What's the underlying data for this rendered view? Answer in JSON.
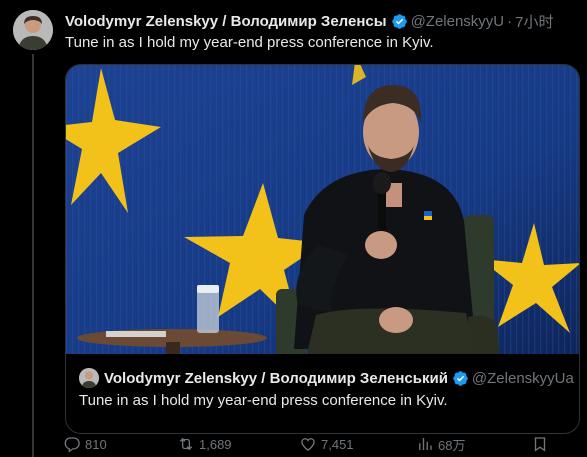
{
  "tweet": {
    "author_name": "Volodymyr Zelenskyy / Володимир Зеленсы",
    "handle": "@ZelenskyyU",
    "separator": "·",
    "time": "7小时",
    "text": "Tune in as I hold my year-end press conference in Kyiv."
  },
  "quote": {
    "author_name": "Volodymyr Zelenskyy / Володимир Зеленський",
    "handle": "@ZelenskyyUa",
    "text": "Tune in as I hold my year-end press conference in Kyiv."
  },
  "actions": {
    "replies": "810",
    "reposts": "1,689",
    "likes": "7,451",
    "views": "68万"
  },
  "colors": {
    "background": "#000000",
    "text_primary": "#e7e9ea",
    "text_secondary": "#71767b",
    "verified_blue": "#1d9bf0",
    "eu_blue": "#1c3f8c",
    "eu_star_yellow": "#f2c21b"
  },
  "icons": [
    "verified-badge-icon",
    "reply-icon",
    "repost-icon",
    "like-icon",
    "views-icon",
    "bookmark-icon"
  ]
}
